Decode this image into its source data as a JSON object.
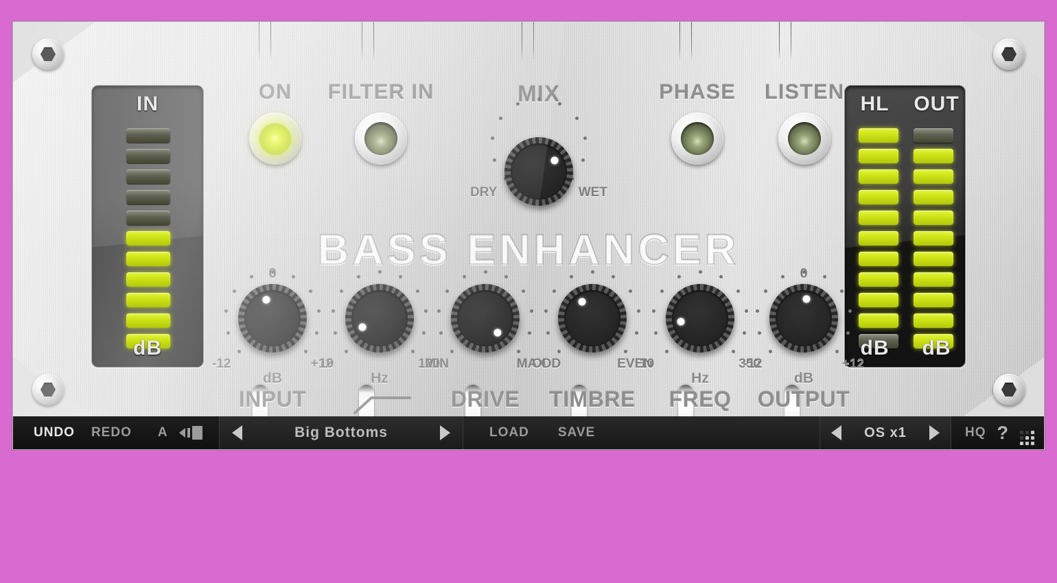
{
  "app": {
    "brand_title": "BASS ENHANCER",
    "background_color": "#d96bd0",
    "accent_led_color": "#cde216",
    "panel_color": "#dcdcdc"
  },
  "meters": {
    "input": {
      "label": "IN",
      "unit": "dB",
      "segments": [
        "off",
        "off",
        "off",
        "off",
        "off",
        "on",
        "on",
        "on",
        "on",
        "on",
        "on"
      ]
    },
    "highlight": {
      "label": "HL",
      "unit": "dB",
      "segments": [
        "on",
        "on",
        "on",
        "on",
        "on",
        "on",
        "on",
        "on",
        "on",
        "on",
        "off"
      ]
    },
    "output": {
      "label": "OUT",
      "unit": "dB",
      "segments": [
        "off",
        "on",
        "on",
        "on",
        "on",
        "on",
        "on",
        "on",
        "on",
        "on",
        "on"
      ]
    }
  },
  "toggles": [
    {
      "name": "on",
      "label": "ON",
      "state": "on"
    },
    {
      "name": "filter-in",
      "label": "FILTER IN",
      "state": "off"
    },
    {
      "name": "phase",
      "label": "PHASE",
      "state": "off"
    },
    {
      "name": "listen",
      "label": "LISTEN",
      "state": "off"
    }
  ],
  "mix_knob": {
    "label": "MIX",
    "min_label": "DRY",
    "max_label": "WET",
    "angle": 55
  },
  "knobs": [
    {
      "name": "input",
      "label": "INPUT",
      "top_value": "0",
      "min_label": "-12",
      "max_label": "+12",
      "unit": "Hz_placeholder",
      "unit_text": "dB",
      "angle": -18
    },
    {
      "name": "filter-freq",
      "label": "",
      "top_value": "",
      "min_label": "10",
      "max_label": "120",
      "unit_text": "Hz",
      "angle": -118
    },
    {
      "name": "drive",
      "label": "DRIVE",
      "top_value": "",
      "min_label": "MIN",
      "max_label": "MAX",
      "unit_text": "",
      "angle": 140
    },
    {
      "name": "timbre",
      "label": "TIMBRE",
      "top_value": "",
      "min_label": "ODD",
      "max_label": "EVEN",
      "unit_text": "",
      "angle": -32
    },
    {
      "name": "freq",
      "label": "FREQ",
      "top_value": "",
      "min_label": "10",
      "max_label": "350",
      "unit_text": "Hz",
      "angle": -100
    },
    {
      "name": "output",
      "label": "OUTPUT",
      "top_value": "0",
      "min_label": "-12",
      "max_label": "+12",
      "unit_text": "dB",
      "angle": 8
    }
  ],
  "bottom_bar": {
    "undo_label": "UNDO",
    "redo_label": "REDO",
    "ab_label": "A",
    "copy_icon": "copy-arrow-icon",
    "preset_prev_icon": "arrow-left-icon",
    "preset_name": "Big Bottoms",
    "preset_next_icon": "arrow-right-icon",
    "load_label": "LOAD",
    "save_label": "SAVE",
    "os_prev_icon": "arrow-left-icon",
    "os_value": "OS x1",
    "os_next_icon": "arrow-right-icon",
    "hq_label": "HQ",
    "help_label": "?",
    "resize_icon": "resize-grip-icon"
  }
}
